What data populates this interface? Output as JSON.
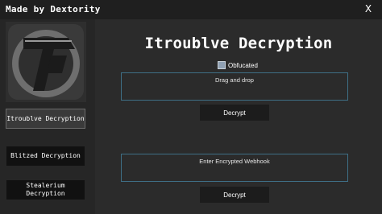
{
  "window": {
    "title": "Made by Dextority",
    "close_label": "X"
  },
  "sidebar": {
    "buttons": [
      {
        "label": "Itroublve Decryption",
        "active": true
      },
      {
        "label": "Blitzed Decryption",
        "active": false
      },
      {
        "label": "Stealerium Decryption",
        "active": false
      }
    ]
  },
  "main": {
    "title": "Itroublve Decryption",
    "obfuscated_label": "Obfucated",
    "drop_box_text": "Drag and drop",
    "decrypt_label_1": "Decrypt",
    "webhook_placeholder": "Enter Encrypted Webhook",
    "decrypt_label_2": "Decrypt"
  },
  "colors": {
    "background": "#1f1f1f",
    "sidebar": "#262626",
    "panel": "#2b2b2b",
    "input_border": "#3e6f86",
    "checkbox": "#8fa0b3"
  }
}
